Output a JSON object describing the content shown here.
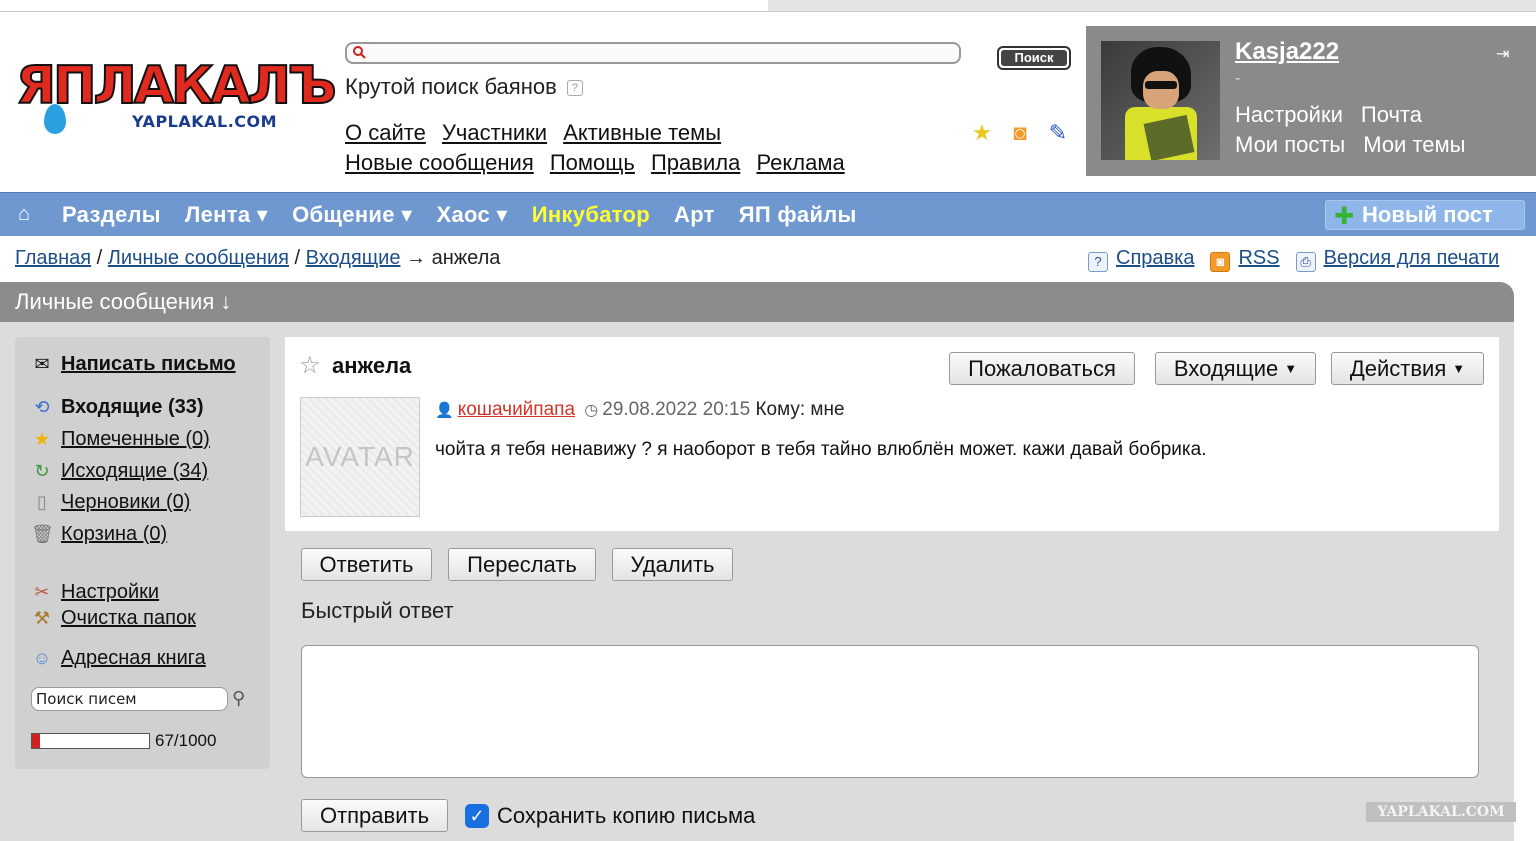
{
  "logo": {
    "wordmark": "ЯПЛАКАЛЪ",
    "domain": "YAPLAKAL.COM"
  },
  "search": {
    "placeholder": "",
    "button_label": "Поиск",
    "hint": "Крутой поиск баянов",
    "hint_help": "?"
  },
  "top_nav": {
    "row1": [
      "О сайте",
      "Участники",
      "Активные темы"
    ],
    "row2": [
      "Новые сообщения",
      "Помощь",
      "Правила",
      "Реклама"
    ]
  },
  "header_icons": [
    "star-add-icon",
    "rss-icon",
    "pencil-icon"
  ],
  "user_panel": {
    "username": "Kasja222",
    "status": "-",
    "links_row1": [
      "Настройки",
      "Почта"
    ],
    "links_row2": [
      "Мои посты",
      "Мои темы"
    ]
  },
  "navbar": {
    "items": [
      "Разделы",
      "Лента ▾",
      "Общение ▾",
      "Хаос ▾",
      "Инкубатор",
      "Арт",
      "ЯП файлы"
    ],
    "highlight": "Инкубатор",
    "new_post": "Новый пост"
  },
  "breadcrumbs": {
    "items": [
      "Главная",
      "Личные сообщения",
      "Входящие"
    ],
    "current": "анжела",
    "separator": " / ",
    "arrow": " → "
  },
  "tools": {
    "help": "Справка",
    "rss": "RSS",
    "print": "Версия для печати"
  },
  "section_title": "Личные сообщения ↓",
  "sidebar": {
    "compose": "Написать письмо",
    "folders": [
      {
        "label": "Входящие (33)",
        "icon": "inbox-icon"
      },
      {
        "label": "Помеченные (0)",
        "icon": "star-icon"
      },
      {
        "label": "Исходящие (34)",
        "icon": "outbox-icon"
      },
      {
        "label": "Черновики (0)",
        "icon": "draft-icon"
      },
      {
        "label": "Корзина (0)",
        "icon": "trash-icon"
      }
    ],
    "settings": "Настройки",
    "cleanup": "Очистка папок",
    "address_book": "Адресная книга",
    "search_placeholder": "Поиск писем",
    "quota_text": "67/1000",
    "quota_used": 67,
    "quota_total": 1000
  },
  "message": {
    "subject": "анжела",
    "buttons": {
      "report": "Пожаловаться",
      "inbox": "Входящие",
      "actions": "Действия"
    },
    "avatar_placeholder": "AVATAR",
    "author": "кошачийпапа",
    "datetime": "29.08.2022 20:15",
    "to_label": "Кому: мне",
    "body": "чойта я тебя ненавижу ? я наоборот в тебя тайно влюблён может. кажи давай бобрика."
  },
  "actions": {
    "reply": "Ответить",
    "forward": "Переслать",
    "delete": "Удалить"
  },
  "quick_reply": {
    "title": "Быстрый ответ",
    "text": "",
    "send": "Отправить",
    "save_copy": "Сохранить копию письма",
    "save_copy_checked": true
  },
  "watermark": "YAPLAKAL.COM",
  "colors": {
    "nav_blue": "#6f98d1",
    "highlight_yellow": "#ffff33",
    "author_red": "#d1352a",
    "panel_gray": "#8a8a8a"
  }
}
